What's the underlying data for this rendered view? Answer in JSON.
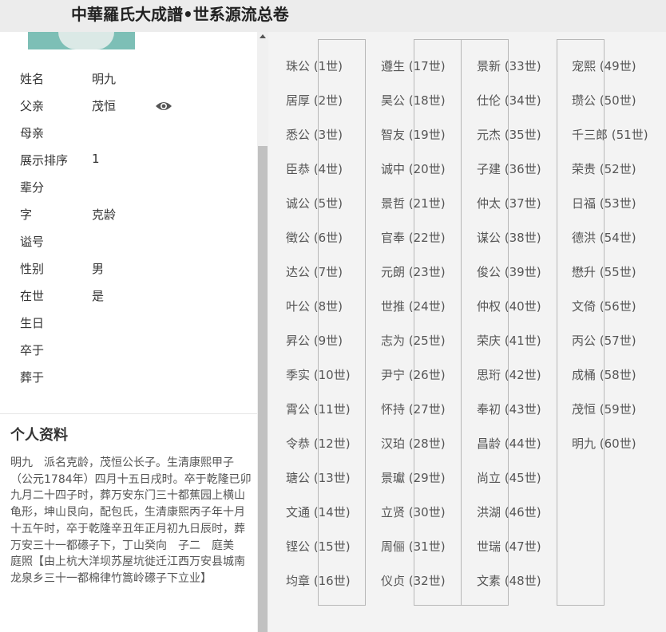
{
  "header": {
    "title": "中華羅氏大成譜•世系源流总卷"
  },
  "profile": {
    "fields": [
      {
        "label": "姓名",
        "value": "明九"
      },
      {
        "label": "父亲",
        "value": "茂恒"
      },
      {
        "label": "母亲",
        "value": ""
      },
      {
        "label": "展示排序",
        "value": "1"
      },
      {
        "label": "辈分",
        "value": ""
      },
      {
        "label": "字",
        "value": "克龄"
      },
      {
        "label": "谥号",
        "value": ""
      },
      {
        "label": "性别",
        "value": "男"
      },
      {
        "label": "在世",
        "value": "是"
      },
      {
        "label": "生日",
        "value": ""
      },
      {
        "label": "卒于",
        "value": ""
      },
      {
        "label": "葬于",
        "value": ""
      }
    ],
    "section_title": "个人资料",
    "bio": "明九　派名克龄，茂恒公长子。生清康熙甲子（公元1784年）四月十五日戌时。卒于乾隆已卯九月二十四子时，葬万安东门三十都蕉园上横山龟形，坤山艮向，配包氏，生清康熙丙子年十月十五午时，卒于乾隆辛丑年正月初九日辰时，葬万安三十一都礤子下，丁山癸向　子二　庭美　庭照【由上杭大洋坝苏屋坑徙迁江西万安县城南龙泉乡三十一都棉律竹篙岭礤子下立业】"
  },
  "icons": {
    "eye": "eye-icon",
    "scroll_up": "scroll-up-arrow-icon"
  },
  "generations": [
    [
      "珠公 (1世)",
      "居厚 (2世)",
      "悉公 (3世)",
      "臣恭 (4世)",
      "诚公 (5世)",
      "徵公 (6世)",
      "达公 (7世)",
      "叶公 (8世)",
      "昇公 (9世)",
      "季实 (10世)",
      "霄公 (11世)",
      "令恭 (12世)",
      "瑭公 (13世)",
      "文通 (14世)",
      "铿公 (15世)",
      "均章 (16世)"
    ],
    [
      "遵生 (17世)",
      "昊公 (18世)",
      "智友 (19世)",
      "诚中 (20世)",
      "景哲 (21世)",
      "官奉 (22世)",
      "元朗 (23世)",
      "世推 (24世)",
      "志为 (25世)",
      "尹宁 (26世)",
      "怀持 (27世)",
      "汉珀 (28世)",
      "景瓛 (29世)",
      "立贤 (30世)",
      "周俪 (31世)",
      "仪贞 (32世)"
    ],
    [
      "景新 (33世)",
      "仕伦 (34世)",
      "元杰 (35世)",
      "子建 (36世)",
      "仲太 (37世)",
      "谋公 (38世)",
      "俊公 (39世)",
      "仲权 (40世)",
      "荣庆 (41世)",
      "思珩 (42世)",
      "奉初 (43世)",
      "昌龄 (44世)",
      "尚立 (45世)",
      "洪湖 (46世)",
      "世瑞 (47世)",
      "文素 (48世)"
    ],
    [
      "宠熙 (49世)",
      "瓒公 (50世)",
      "千三郎 (51世)",
      "荣贵 (52世)",
      "日福 (53世)",
      "德洪 (54世)",
      "懋升 (55世)",
      "文倚 (56世)",
      "丙公 (57世)",
      "成桶 (58世)",
      "茂恒 (59世)",
      "明九 (60世)"
    ]
  ]
}
